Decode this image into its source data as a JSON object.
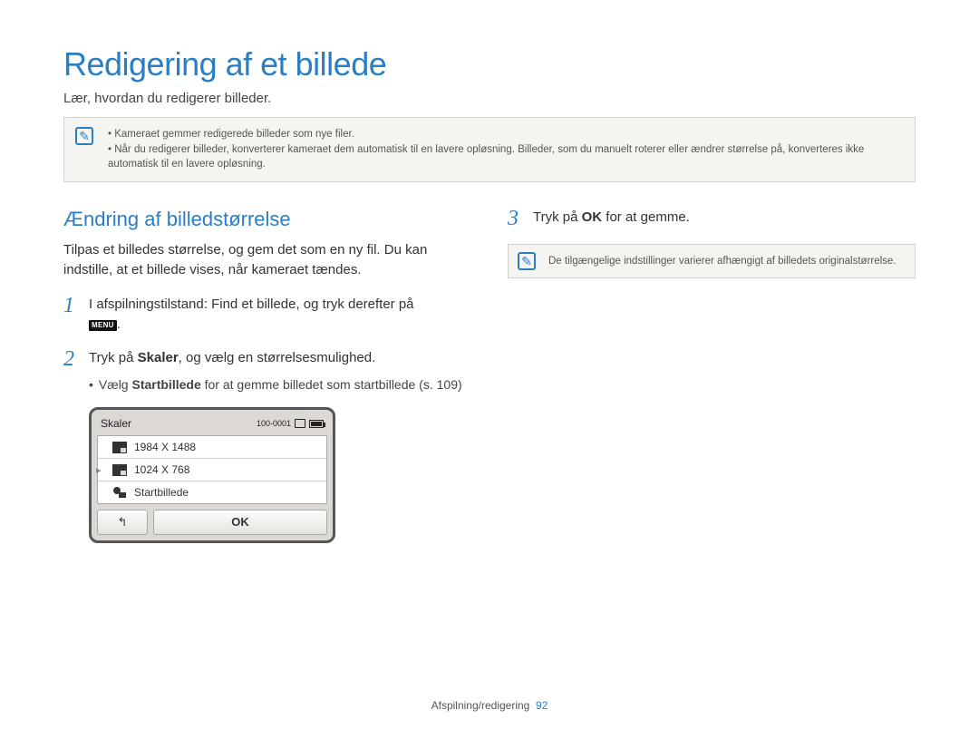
{
  "title": "Redigering af et billede",
  "subtitle": "Lær, hvordan du redigerer billeder.",
  "topbox": {
    "line1": "Kameraet gemmer redigerede billeder som nye filer.",
    "line2": "Når du redigerer billeder, konverterer kameraet dem automatisk til en lavere opløsning. Billeder, som du manuelt roterer eller ændrer størrelse på, konverteres ikke automatisk til en lavere opløsning."
  },
  "section": {
    "title": "Ændring af billedstørrelse",
    "intro": "Tilpas et billedes størrelse, og gem det som en ny fil. Du kan indstille, at et billede vises, når kameraet tændes."
  },
  "steps": {
    "one": {
      "num": "1",
      "text": "I afspilningstilstand: Find et billede, og tryk derefter på",
      "menu_label": "MENU",
      "trailing": "."
    },
    "two": {
      "num": "2",
      "pre": "Tryk på ",
      "bold": "Skaler",
      "post": ", og vælg en størrelsesmulighed.",
      "sub_pre": "Vælg ",
      "sub_bold": "Startbillede",
      "sub_post": " for at gemme billedet som startbillede (s. 109)"
    },
    "three": {
      "num": "3",
      "pre": "Tryk på ",
      "ok": "OK",
      "post": " for at gemme."
    }
  },
  "device": {
    "header_title": "Skaler",
    "file_id": "100-0001",
    "options": [
      "1984 X 1488",
      "1024 X 768",
      "Startbillede"
    ],
    "selected_index": 1,
    "back_symbol": "↰",
    "ok_label": "OK"
  },
  "rightbox": "De tilgængelige indstillinger varierer afhængigt af billedets originalstørrelse.",
  "footer": {
    "section": "Afspilning/redigering",
    "page": "92"
  }
}
